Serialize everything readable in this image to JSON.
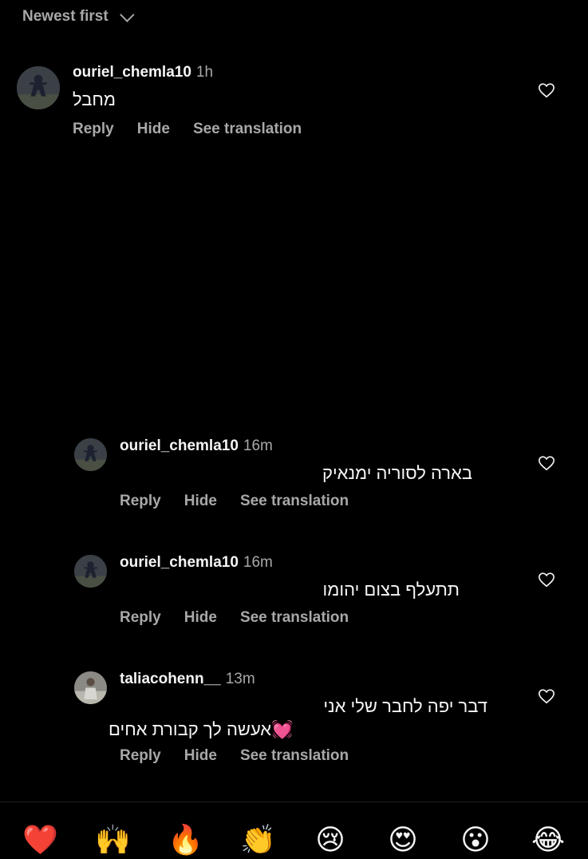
{
  "sort": {
    "label": "Newest first"
  },
  "comments": [
    {
      "username": "ouriel_chemla10",
      "time": "1h",
      "text": "מחבל",
      "reply": "Reply",
      "hide": "Hide",
      "translate": "See translation"
    },
    {
      "username": "ouriel_chemla10",
      "time": "16m",
      "text": "בארה לסוריה ימנאיק",
      "reply": "Reply",
      "hide": "Hide",
      "translate": "See translation"
    },
    {
      "username": "ouriel_chemla10",
      "time": "16m",
      "text": "תתעלף בצום יהומו",
      "reply": "Reply",
      "hide": "Hide",
      "translate": "See translation"
    },
    {
      "username": "taliacohenn__",
      "time": "13m",
      "text_line1": "דבר יפה לחבר שלי אני",
      "text_line2": "💓אעשה לך קבורת אחים",
      "reply": "Reply",
      "hide": "Hide",
      "translate": "See translation"
    }
  ],
  "reactions": [
    "❤️",
    "🙌",
    "🔥",
    "👏",
    "😢",
    "😍",
    "😮",
    "😂"
  ]
}
